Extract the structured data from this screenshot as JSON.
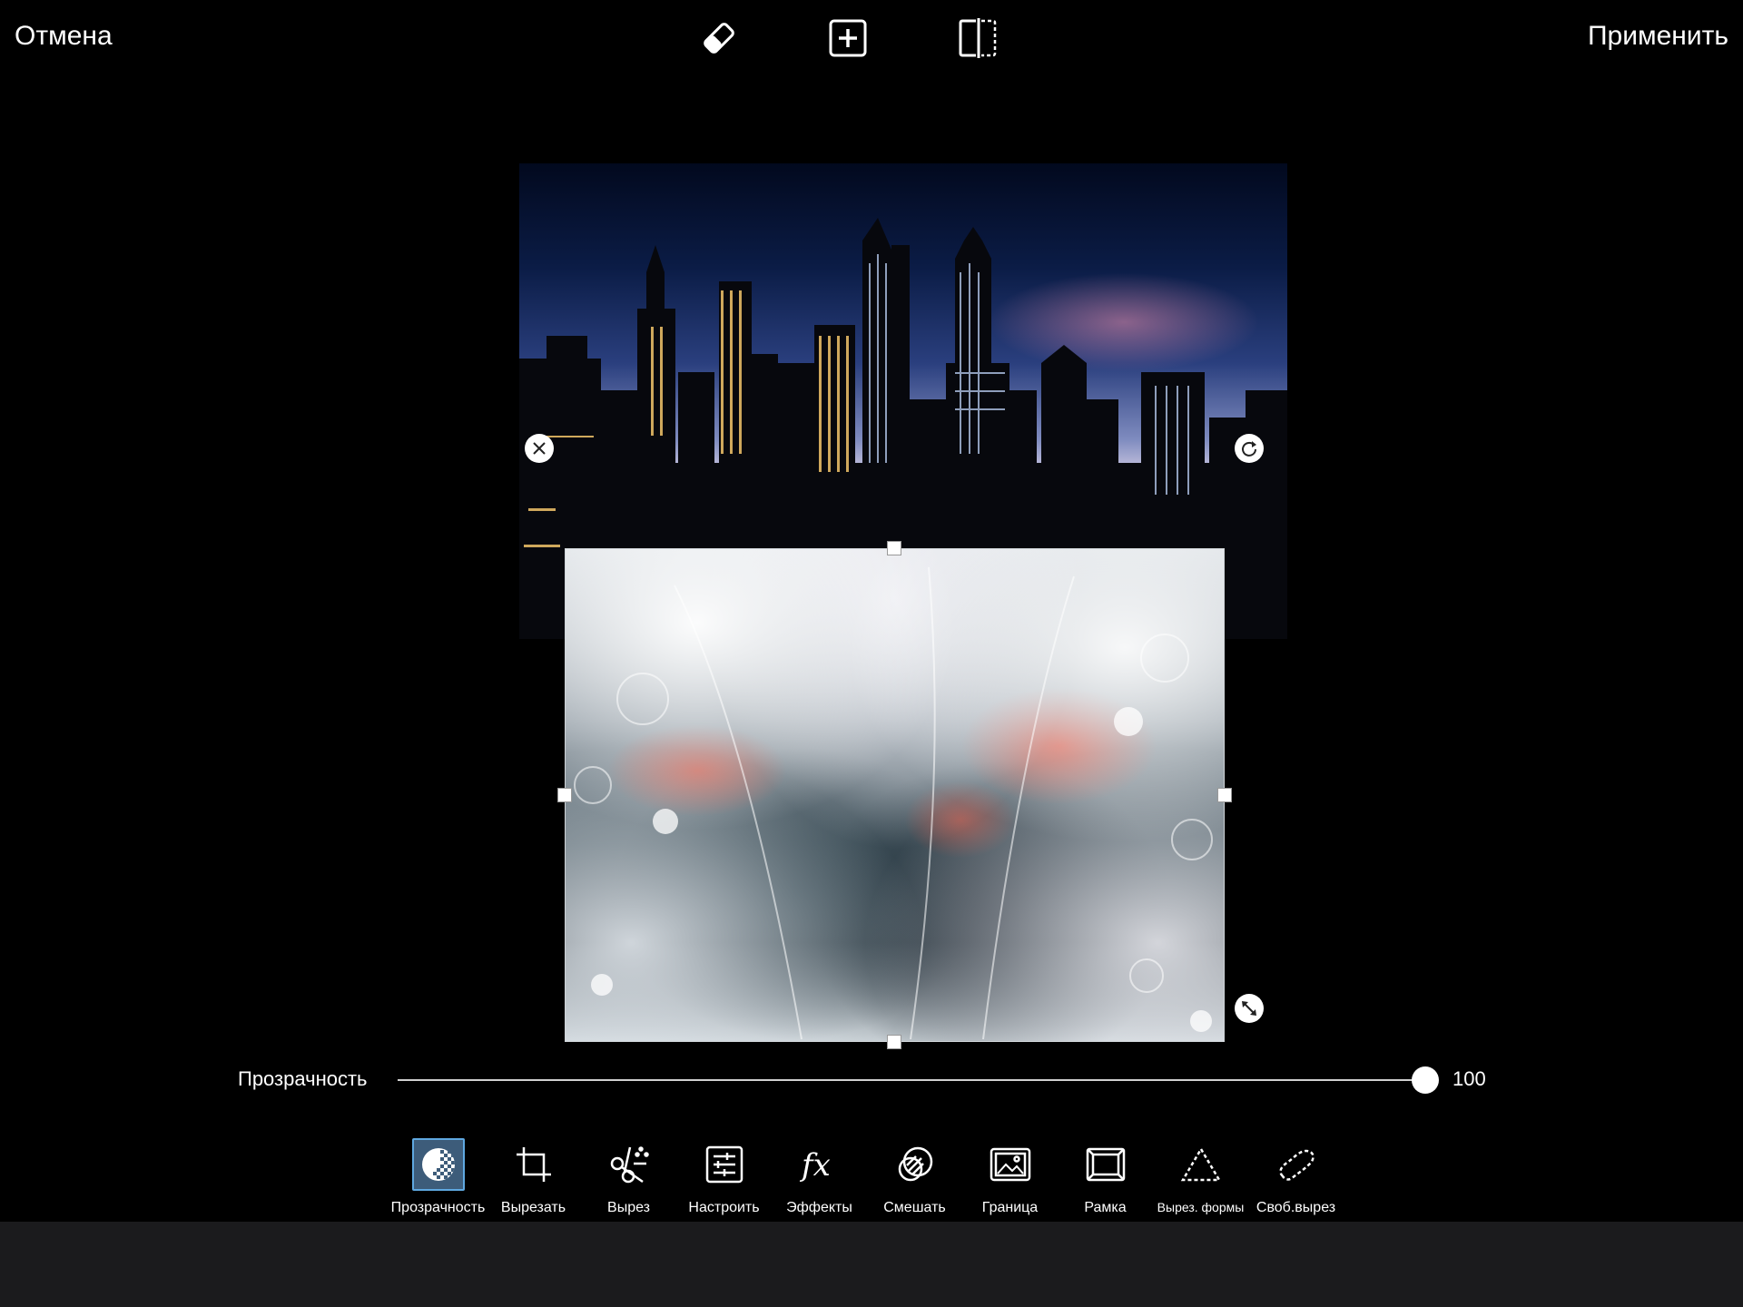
{
  "header": {
    "cancel_label": "Отмена",
    "apply_label": "Применить",
    "icons": [
      "eraser-icon",
      "add-layer-icon",
      "compare-icon"
    ]
  },
  "slider": {
    "label": "Прозрачность",
    "value": "100",
    "fraction": 1.0
  },
  "toolbar": {
    "items": [
      {
        "label": "Прозрачность",
        "icon": "transparency-icon",
        "active": true
      },
      {
        "label": "Вырезать",
        "icon": "crop-icon"
      },
      {
        "label": "Вырез",
        "icon": "cutout-scissors-icon"
      },
      {
        "label": "Настроить",
        "icon": "adjust-icon"
      },
      {
        "label": "Эффекты",
        "icon": "effects-fx-icon"
      },
      {
        "label": "Смешать",
        "icon": "blend-icon"
      },
      {
        "label": "Граница",
        "icon": "border-icon"
      },
      {
        "label": "Рамка",
        "icon": "frame-icon"
      },
      {
        "label": "Вырез. формы",
        "icon": "shape-crop-icon"
      },
      {
        "label": "Своб.вырез",
        "icon": "free-crop-icon"
      }
    ]
  },
  "colors": {
    "background": "#000000",
    "accent": "#5fa8e0",
    "active_fill": "#3d5c7a",
    "bottom_strip": "#1b1b1d"
  }
}
